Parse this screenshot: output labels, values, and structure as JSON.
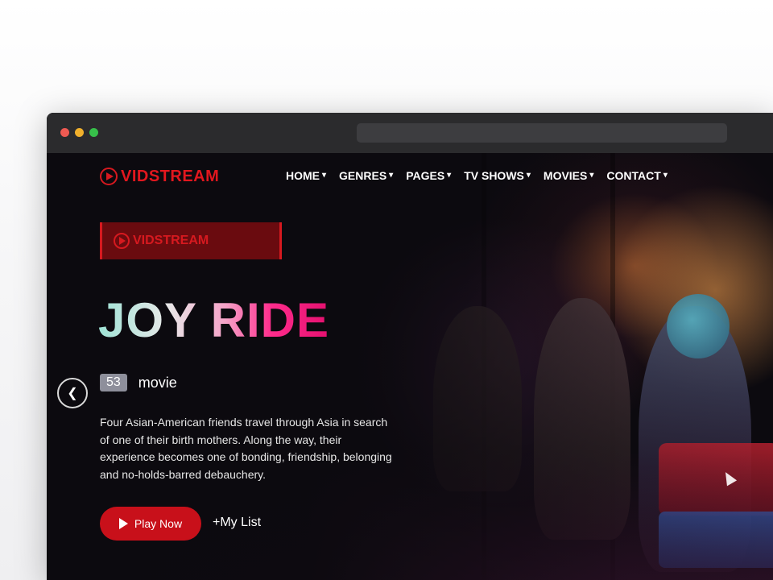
{
  "site": {
    "logo_text": "VIDSTREAM",
    "brand_color": "#d6191f"
  },
  "nav": {
    "items": [
      {
        "label": "HOME"
      },
      {
        "label": "GENRES"
      },
      {
        "label": "PAGES"
      },
      {
        "label": "TV SHOWS"
      },
      {
        "label": "MOVIES"
      },
      {
        "label": "CONTACT"
      }
    ],
    "chevron": "⌄"
  },
  "hero": {
    "banner_text": "VIDSTREAM",
    "title": "JOY RIDE",
    "rating": "53",
    "type": "movie",
    "description": "Four Asian-American friends travel through Asia in search of one of their birth mothers. Along the way, their experience becomes one of bonding, friendship, belonging and no-holds-barred debauchery.",
    "play_label": "Play Now",
    "mylist_label": "+My List",
    "prev_icon": "chevron-left"
  }
}
